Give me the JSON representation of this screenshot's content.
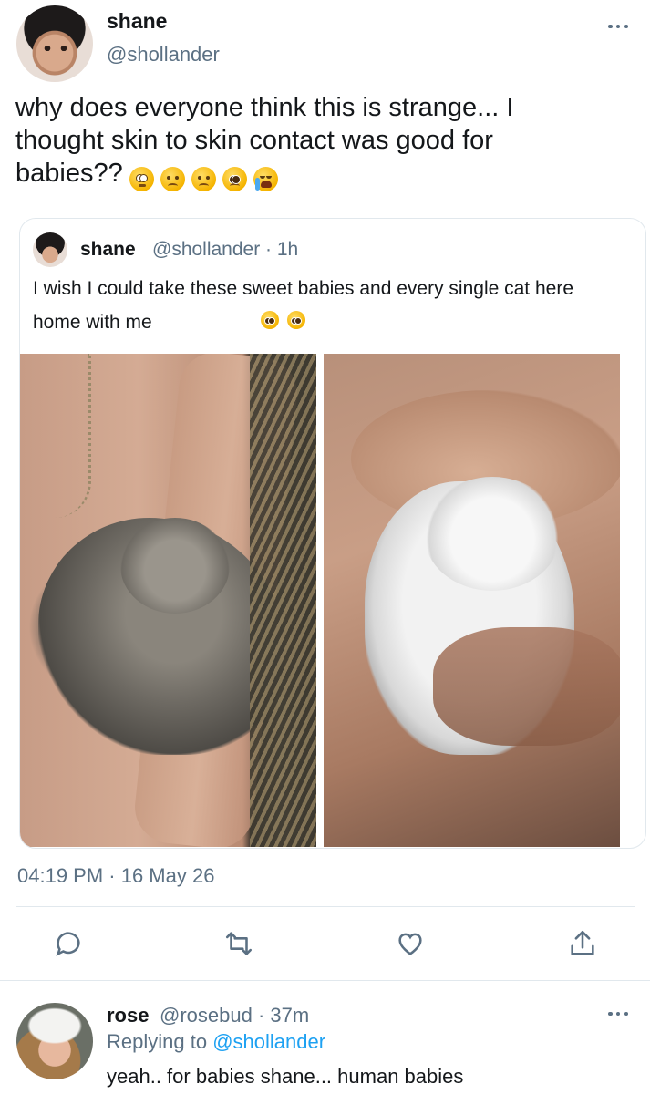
{
  "tweet": {
    "name": "shane",
    "handle": "@shollander",
    "text": "why does everyone think this is strange... I\nthought skin to skin contact was good for\nbabies??",
    "emojis": [
      "flushed-face",
      "disappointed-face",
      "frowning-face",
      "pleading-face",
      "loudly-crying-face"
    ],
    "timestamp": "04:19 PM · 16 May 26"
  },
  "quoted": {
    "name": "shane",
    "handle_time": "@shollander · 1h",
    "text": "I wish I could take these sweet babies and every single cat here home with me",
    "emojis": [
      "pleading-face",
      "pleading-face"
    ],
    "images": [
      "photo-grey-kitten",
      "photo-white-cat"
    ]
  },
  "actions": {
    "icons": [
      "reply-icon",
      "retweet-icon",
      "like-icon",
      "share-icon"
    ]
  },
  "reply": {
    "name": "rose",
    "handle_time": "@rosebud · 37m",
    "replying_prefix": "Replying to ",
    "replying_to": "@shollander",
    "text": "yeah.. for babies shane... human babies"
  },
  "colors": {
    "secondary_text": "#5b7083",
    "link": "#1da1f2",
    "border": "#e1e8ed"
  }
}
